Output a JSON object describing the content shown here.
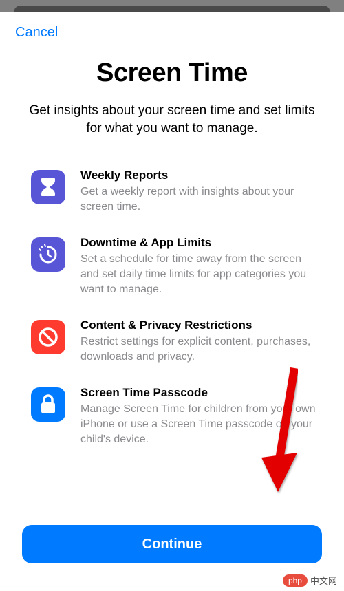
{
  "header": {
    "cancel_label": "Cancel"
  },
  "titleBlock": {
    "title": "Screen Time",
    "subtitle": "Get insights about your screen time and set limits for what you want to manage."
  },
  "features": [
    {
      "icon": "hourglass-icon",
      "iconColor": "purple",
      "title": "Weekly Reports",
      "desc": "Get a weekly report with insights about your screen time."
    },
    {
      "icon": "downtime-icon",
      "iconColor": "purple",
      "title": "Downtime & App Limits",
      "desc": "Set a schedule for time away from the screen and set daily time limits for app categories you want to manage."
    },
    {
      "icon": "no-entry-icon",
      "iconColor": "red",
      "title": "Content & Privacy Restrictions",
      "desc": "Restrict settings for explicit content, purchases, downloads and privacy."
    },
    {
      "icon": "lock-icon",
      "iconColor": "blue",
      "title": "Screen Time Passcode",
      "desc": "Manage Screen Time for children from your own iPhone or use a Screen Time passcode on your child's device."
    }
  ],
  "actions": {
    "continue_label": "Continue"
  },
  "watermark": {
    "badge": "php",
    "text": "中文网"
  }
}
